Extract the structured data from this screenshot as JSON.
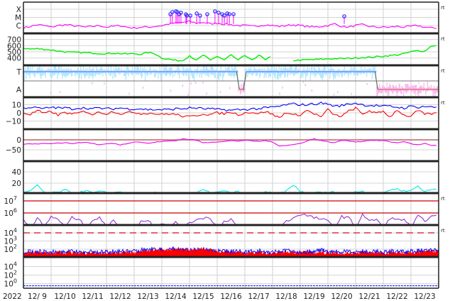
{
  "chart_data": {
    "type": "line",
    "title": "",
    "x_axis": {
      "year_label": "2022",
      "start": "2022-12-09 00:00",
      "days": 15,
      "samples_per_day": 4,
      "tick_labels": [
        "12/ 9",
        "12/10",
        "12/11",
        "12/12",
        "12/13",
        "12/14",
        "12/15",
        "12/16",
        "12/17",
        "12/18",
        "12/19",
        "12/20",
        "12/21",
        "12/22",
        "12/23"
      ]
    },
    "panels": [
      {
        "id": "xray",
        "tick_labels": [
          {
            "text": "X",
            "value": -4
          },
          {
            "text": "M",
            "value": -5
          },
          {
            "text": "C",
            "value": -6
          }
        ],
        "right_label": "rt",
        "series": [
          {
            "name": "xray-flux-log",
            "color": "#ff00ff",
            "values": [
              -6.3,
              -6.1,
              -5.9,
              -6.0,
              -6.2,
              -6.0,
              -5.9,
              -6.0,
              -6.1,
              -6.2,
              -6.1,
              -6.0,
              -6.2,
              -6.1,
              -6.0,
              -6.2,
              -6.3,
              -6.2,
              -6.2,
              -6.1,
              -6.0,
              -5.8,
              -5.7,
              -5.6,
              -5.5,
              -5.7,
              -5.6,
              -5.8,
              -5.7,
              -5.8,
              -5.9,
              -6.0,
              -6.0,
              -6.1,
              -6.0,
              -5.9,
              -6.0,
              -6.1,
              -6.0,
              -5.9,
              -6.0,
              -6.1,
              -6.2,
              -6.1,
              -6.0,
              -5.8,
              -6.1,
              -6.2,
              -6.0,
              -5.9,
              -6.1,
              -6.2,
              -6.2,
              -6.2,
              -6.1,
              -6.2,
              -6.1,
              -6.0,
              -6.2,
              -6.3
            ]
          }
        ],
        "flare_markers": {
          "color": "#2a2aff",
          "day": [
            5.31,
            5.38,
            5.51,
            5.56,
            5.62,
            5.69,
            5.87,
            5.9,
            6.03,
            6.26,
            6.38,
            6.64,
            6.92,
            7.05,
            7.18,
            7.26,
            7.36,
            7.44,
            7.59,
            11.59
          ],
          "log_flux": [
            -4.61,
            -4.35,
            -4.26,
            -4.35,
            -4.61,
            -4.43,
            -4.61,
            -4.78,
            -4.78,
            -4.52,
            -4.78,
            -4.61,
            -4.26,
            -4.43,
            -4.61,
            -4.78,
            -4.52,
            -4.61,
            -4.61,
            -4.87
          ]
        }
      },
      {
        "id": "solar-wind-speed",
        "tick_labels": [
          {
            "text": "700",
            "value": 700
          },
          {
            "text": "600",
            "value": 600
          },
          {
            "text": "500",
            "value": 500
          },
          {
            "text": "400",
            "value": 400
          }
        ],
        "right_label": "rt",
        "series": [
          {
            "name": "speed",
            "color": "#00ee00",
            "values": [
              560,
              545,
              550,
              540,
              530,
              515,
              500,
              490,
              490,
              485,
              480,
              475,
              470,
              480,
              470,
              465,
              470,
              460,
              490,
              470,
              400,
              380,
              360,
              360,
              440,
              360,
              450,
              360,
              430,
              370,
              450,
              360,
              440,
              360,
              450,
              365,
              440,
              null,
              null,
              360,
              365,
              370,
              375,
              380,
              385,
              390,
              390,
              395,
              400,
              410,
              410,
              420,
              430,
              440,
              450,
              470,
              500,
              520,
              510,
              600
            ]
          }
        ]
      },
      {
        "id": "imf-mode",
        "tick_labels": [
          {
            "text": "T",
            "value": "T"
          },
          {
            "text": "A",
            "value": "A"
          }
        ],
        "right_label": "rt",
        "series": [
          {
            "name": "mode",
            "colors": {
              "T": "#aee6ff",
              "A": "#f7b8f0",
              "line_T": "#6f7fff",
              "line_A": "#e07070"
            },
            "values": [
              "T",
              "T",
              "T",
              "T",
              "T",
              "T",
              "T",
              "T",
              "T",
              "T",
              "T",
              "T",
              "T",
              "T",
              "T",
              "T",
              "T",
              "T",
              "T",
              "T",
              "T",
              "T",
              "T",
              "T",
              "T",
              "T",
              "T",
              "T",
              "T",
              "T",
              "T",
              "A",
              "T",
              "T",
              "T",
              "T",
              "T",
              "T",
              "T",
              "T",
              "T",
              "T",
              "T",
              "T",
              "T",
              "T",
              "T",
              "T",
              "T",
              "T",
              "T",
              "A",
              "A",
              "A",
              "A",
              "A",
              "A",
              "A",
              "A",
              "A"
            ]
          }
        ]
      },
      {
        "id": "imf-bz-bt",
        "tick_labels": [
          {
            "text": "10",
            "value": 10
          },
          {
            "text": "0",
            "value": 0
          },
          {
            "text": "−10",
            "value": -10
          }
        ],
        "right_label": "rt",
        "series": [
          {
            "name": "Bt",
            "color": "#0000ff",
            "values": [
              6,
              7,
              6,
              5,
              7,
              6,
              6,
              5,
              6,
              6,
              5,
              6,
              5,
              5,
              6,
              5,
              5,
              5,
              4,
              4,
              4,
              4,
              5,
              5,
              6,
              6,
              5,
              5,
              4,
              4,
              3,
              4,
              4,
              5,
              5,
              6,
              7,
              8,
              10,
              11,
              10,
              10,
              11,
              12,
              11,
              8,
              9,
              11,
              12,
              10,
              9,
              9,
              8,
              8,
              7,
              6,
              8,
              7,
              8,
              7
            ]
          },
          {
            "name": "Bz",
            "color": "#ff0000",
            "values": [
              0,
              -2,
              3,
              -1,
              2,
              -3,
              1,
              -2,
              0,
              2,
              -2,
              1,
              -1,
              2,
              -1,
              0,
              1,
              -1,
              0,
              -1,
              -2,
              -1,
              -2,
              -4,
              -5,
              -3,
              -1,
              -2,
              0,
              -1,
              1,
              -2,
              0,
              1,
              -1,
              2,
              -2,
              -6,
              1,
              -3,
              -2,
              3,
              -1,
              -5,
              4,
              -3,
              -4,
              2,
              6,
              -2,
              3,
              -1,
              2,
              -5,
              4,
              -3,
              -4,
              3,
              -2,
              -1
            ]
          }
        ]
      },
      {
        "id": "dst",
        "tick_labels": [
          {
            "text": "0",
            "value": 0
          },
          {
            "text": "−50",
            "value": -50
          }
        ],
        "series": [
          {
            "name": "dst",
            "color": "#ee00ee",
            "values": [
              -22,
              -20,
              -20,
              -18,
              -18,
              -16,
              -15,
              -18,
              -15,
              -12,
              -18,
              -25,
              -20,
              -18,
              -25,
              -18,
              -10,
              -12,
              -18,
              -12,
              -8,
              -6,
              -5,
              5,
              2,
              -2,
              -15,
              -12,
              -10,
              -8,
              -4,
              -6,
              -2,
              -5,
              -8,
              -4,
              -12,
              -30,
              -28,
              -24,
              -18,
              -5,
              5,
              -3,
              -10,
              -14,
              -2,
              -5,
              -10,
              -8,
              -2,
              -3,
              -4,
              -10,
              -15,
              -8,
              -20,
              -25,
              -18,
              -28
            ]
          }
        ],
        "reference_line": {
          "value": 0,
          "color": "#c06060"
        }
      },
      {
        "id": "cyan-index",
        "tick_labels": [
          {
            "text": "40",
            "value": 40
          },
          {
            "text": "20",
            "value": 20
          }
        ],
        "series": [
          {
            "name": "index",
            "color": "#00e8e8",
            "values": [
              4,
              6,
              16,
              4,
              3,
              4,
              8,
              3,
              3,
              7,
              3,
              5,
              4,
              3,
              5,
              3,
              2,
              2,
              1,
              3,
              2,
              1,
              3,
              1,
              2,
              3,
              8,
              3,
              4,
              6,
              3,
              5,
              1,
              2,
              3,
              5,
              2,
              2,
              6,
              17,
              5,
              3,
              3,
              4,
              3,
              5,
              2,
              3,
              5,
              6,
              2,
              0,
              4,
              8,
              10,
              6,
              7,
              15,
              5,
              9
            ]
          }
        ]
      },
      {
        "id": "electron-flux",
        "tick_labels": [
          {
            "text": "10",
            "exp": "7",
            "value": 7
          },
          {
            "text": "10",
            "exp": "6",
            "value": 6
          }
        ],
        "right_label": "rt",
        "series": [
          {
            "name": "electron-log",
            "color": "#9a30d0",
            "values": [
              5.5,
              4.8,
              5.6,
              4.8,
              5.7,
              5.5,
              4.8,
              5.6,
              5.5,
              4.8,
              5.4,
              5.6,
              4.8,
              5.5,
              4.8,
              5.0,
              4.8,
              5.3,
              5.4,
              4.8,
              5.2,
              4.8,
              5.2,
              4.8,
              5.1,
              5.5,
              5.6,
              5.6,
              4.8,
              5.3,
              5.5,
              4.8,
              4.8,
              4.7,
              4.7,
              4.8,
              4.7,
              4.8,
              5.3,
              5.6,
              5.9,
              5.8,
              5.6,
              5.5,
              5.3,
              4.8,
              5.7,
              5.6,
              4.8,
              5.9,
              5.3,
              5.5,
              4.8,
              5.6,
              5.4,
              5.5,
              4.8,
              5.7,
              5.4,
              5.7
            ]
          }
        ],
        "reference_lines": [
          {
            "value": 7,
            "color": "#cc0000"
          },
          {
            "value": 6,
            "color": "#cc0000"
          }
        ]
      },
      {
        "id": "proton-flux",
        "tick_labels": [
          {
            "text": "10",
            "exp": "4",
            "value": 4
          },
          {
            "text": "10",
            "exp": "3",
            "value": 3
          },
          {
            "text": "10",
            "exp": "2",
            "value": 2
          }
        ],
        "right_label": "rt",
        "series": [
          {
            "name": "red-flux-log",
            "color": "#ff0000",
            "values": [
              1.8,
              1.9,
              1.8,
              1.9,
              1.8,
              1.9,
              1.8,
              1.9,
              1.8,
              1.8,
              1.9,
              1.8,
              1.8,
              1.9,
              1.8,
              1.9,
              1.9,
              2.0,
              2.1,
              2.2,
              2.2,
              2.3,
              2.3,
              2.2,
              2.2,
              2.3,
              2.3,
              2.2,
              2.0,
              1.9,
              1.9,
              1.9,
              1.8,
              1.9,
              1.9,
              1.8,
              1.8,
              1.9,
              2.0,
              1.9,
              1.8,
              1.9,
              1.8,
              1.9,
              1.8,
              1.9,
              1.8,
              1.8,
              1.8,
              1.9,
              1.8,
              1.9,
              1.8,
              1.8,
              1.9,
              1.8,
              1.9,
              1.9,
              2.0,
              2.0
            ]
          },
          {
            "name": "blue-flux-log",
            "color": "#0000ff",
            "values": [
              1.9,
              2.0,
              1.9,
              2.0,
              1.9,
              2.0,
              1.9,
              2.0,
              1.9,
              1.9,
              2.0,
              1.9,
              1.9,
              2.0,
              2.0,
              2.0,
              2.0,
              2.2,
              2.3,
              2.3,
              2.1,
              2.3,
              2.3,
              2.2,
              2.1,
              2.2,
              2.3,
              2.1,
              2.0,
              2.0,
              2.0,
              2.0,
              1.9,
              2.0,
              2.1,
              1.9,
              1.9,
              2.0,
              2.1,
              2.0,
              1.9,
              2.0,
              1.9,
              2.2,
              1.9,
              2.0,
              1.9,
              2.0,
              1.9,
              2.0,
              1.9,
              2.0,
              1.9,
              2.0,
              2.0,
              1.9,
              2.0,
              2.1,
              2.1,
              2.2
            ]
          }
        ],
        "reference_line": {
          "value": 4,
          "color": "#dd3333",
          "dashed": true
        }
      },
      {
        "id": "high-energy-proton",
        "tick_labels": [
          {
            "text": "10",
            "exp": "4",
            "value": 4
          },
          {
            "text": "10",
            "exp": "2",
            "value": 2
          },
          {
            "text": "10",
            "exp": "0",
            "value": 0
          }
        ],
        "series": [
          {
            "name": "flux-log",
            "color": "#2030ff",
            "constant": -0.5
          }
        ]
      }
    ]
  }
}
